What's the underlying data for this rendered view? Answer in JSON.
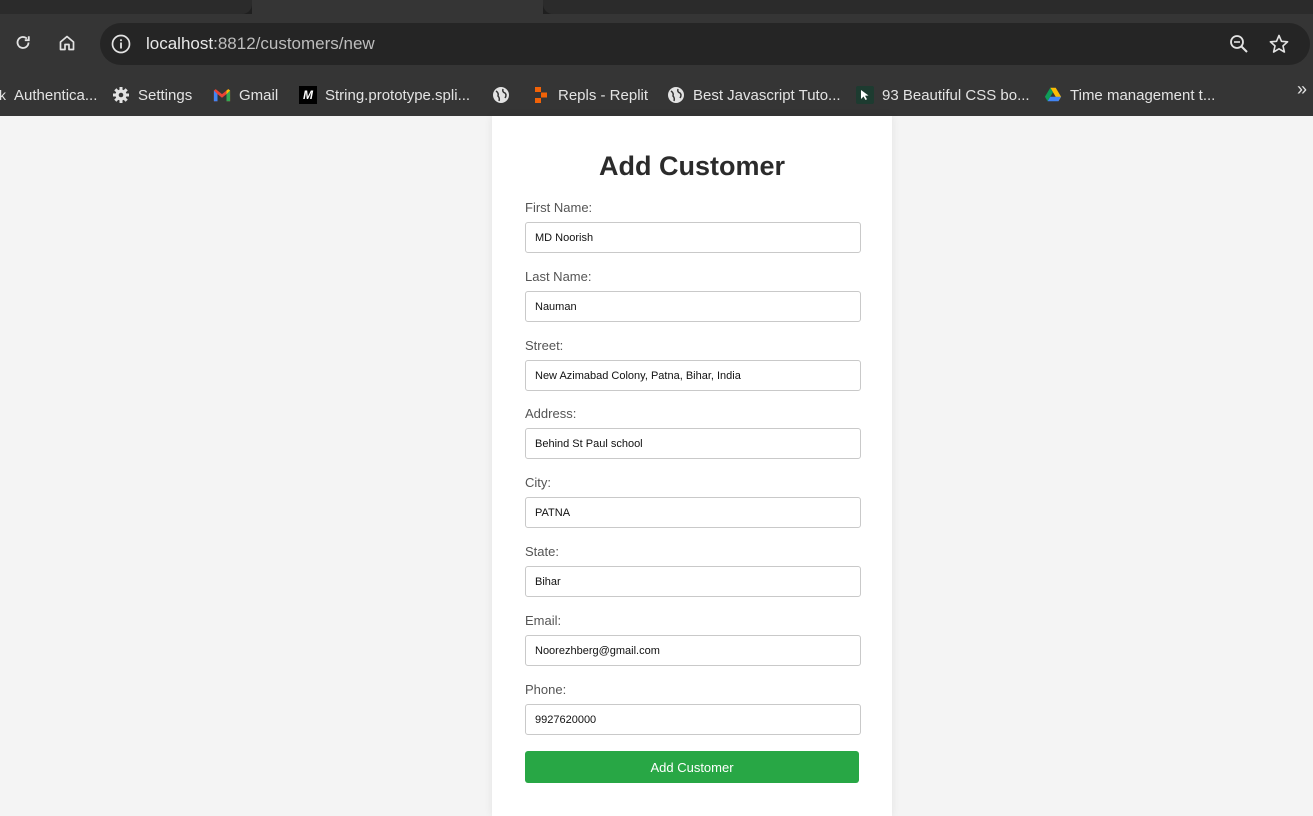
{
  "browser": {
    "url_host": "localhost",
    "url_rest": ":8812/customers/new",
    "bookmarks": [
      {
        "label": "Authentica...",
        "icon": "key-icon"
      },
      {
        "label": "Settings",
        "icon": "gear-icon"
      },
      {
        "label": "Gmail",
        "icon": "gmail-icon"
      },
      {
        "label": "String.prototype.spli...",
        "icon": "mdn-icon"
      },
      {
        "label": "",
        "icon": "globe-icon"
      },
      {
        "label": "Repls - Replit",
        "icon": "replit-icon"
      },
      {
        "label": "Best Javascript Tuto...",
        "icon": "globe-icon"
      },
      {
        "label": "93 Beautiful CSS bo...",
        "icon": "cursor-icon"
      },
      {
        "label": "Time management t...",
        "icon": "drive-icon"
      }
    ],
    "more_label": "»"
  },
  "form": {
    "title": "Add Customer",
    "fields": [
      {
        "label": "First Name:",
        "value": "MD Noorish"
      },
      {
        "label": "Last Name:",
        "value": "Nauman"
      },
      {
        "label": "Street:",
        "value": "New Azimabad Colony, Patna, Bihar, India"
      },
      {
        "label": "Address:",
        "value": "Behind St Paul school"
      },
      {
        "label": "City:",
        "value": "PATNA"
      },
      {
        "label": "State:",
        "value": "Bihar"
      },
      {
        "label": "Email:",
        "value": "Noorezhberg@gmail.com"
      },
      {
        "label": "Phone:",
        "value": "9927620000"
      }
    ],
    "submit_label": "Add Customer"
  },
  "colors": {
    "accent_button": "#28a745",
    "chrome_dark": "#353535",
    "page_bg": "#f4f4f4"
  }
}
